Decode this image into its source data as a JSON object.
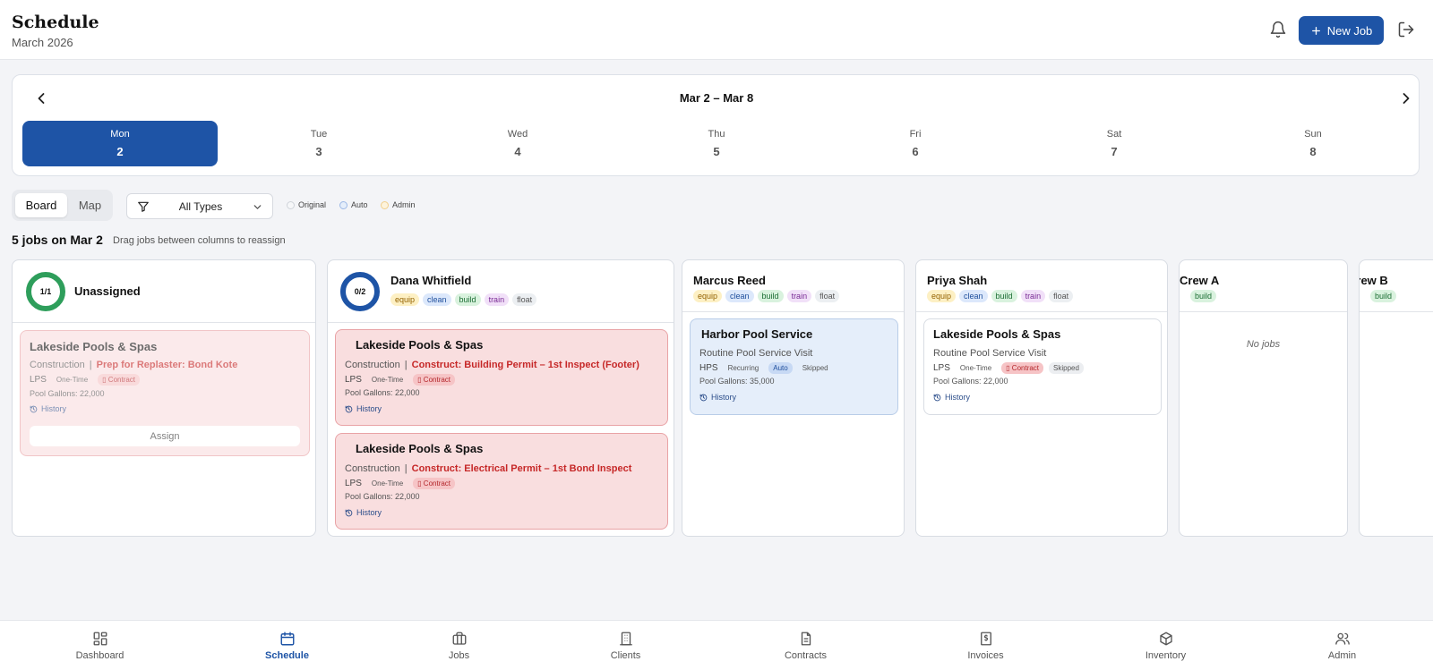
{
  "header": {
    "title": "Schedule",
    "subtitle": "March 2026",
    "new_job_label": "New Job"
  },
  "week": {
    "range_label": "Mar 2 – Mar 8",
    "days": [
      {
        "name": "Mon",
        "num": "2",
        "active": true
      },
      {
        "name": "Tue",
        "num": "3"
      },
      {
        "name": "Wed",
        "num": "4"
      },
      {
        "name": "Thu",
        "num": "5"
      },
      {
        "name": "Fri",
        "num": "6"
      },
      {
        "name": "Sat",
        "num": "7"
      },
      {
        "name": "Sun",
        "num": "8"
      }
    ]
  },
  "toolbar": {
    "view_board": "Board",
    "view_map": "Map",
    "type_filter": "All Types",
    "legend": [
      {
        "label": "Original",
        "color": "#cfd3d9"
      },
      {
        "label": "Auto",
        "color": "#9db9e6"
      },
      {
        "label": "Admin",
        "color": "#f1cf8d"
      }
    ]
  },
  "summary": {
    "count": "5 jobs on Mar 2",
    "hint": "Drag jobs between columns to reassign"
  },
  "columns": [
    {
      "name": "Unassigned",
      "ring": "1/1",
      "ring_color": "#2e9e5b",
      "jobs": [
        {
          "title": "Lakeside Pools & Spas",
          "category": "Construction",
          "task": "Prep for Replaster: Bond Kote",
          "code": "LPS",
          "freq": "One-Time",
          "contract": "Contract",
          "gallons": "Pool Gallons: 22,000",
          "history": "History",
          "assign": "Assign"
        }
      ]
    },
    {
      "name": "Dana Whitfield",
      "ring": "0/2",
      "ring_color": "#1e54a6",
      "tags": [
        "equip",
        "clean",
        "build",
        "train",
        "float"
      ],
      "jobs": [
        {
          "title": "Lakeside Pools & Spas",
          "category": "Construction",
          "task": "Construct: Building Permit – 1st Inspect (Footer)",
          "code": "LPS",
          "freq": "One-Time",
          "contract": "Contract",
          "gallons": "Pool Gallons: 22,000",
          "history": "History"
        },
        {
          "title": "Lakeside Pools & Spas",
          "category": "Construction",
          "task": "Construct: Electrical Permit – 1st Bond Inspect",
          "code": "LPS",
          "freq": "One-Time",
          "contract": "Contract",
          "gallons": "Pool Gallons: 22,000",
          "history": "History"
        }
      ]
    },
    {
      "name": "Marcus Reed",
      "tags": [
        "equip",
        "clean",
        "build",
        "train",
        "float"
      ],
      "jobs": [
        {
          "title": "Harbor Pool Service",
          "service": "Routine Pool Service Visit",
          "code": "HPS",
          "freq": "Recurring",
          "badge": "Auto",
          "status": "Skipped",
          "gallons": "Pool Gallons: 35,000",
          "history": "History"
        }
      ]
    },
    {
      "name": "Priya Shah",
      "tags": [
        "equip",
        "clean",
        "build",
        "train",
        "float"
      ],
      "jobs": [
        {
          "title": "Lakeside Pools & Spas",
          "service": "Routine Pool Service Visit",
          "code": "LPS",
          "freq": "One-Time",
          "contract": "Contract",
          "status": "Skipped",
          "gallons": "Pool Gallons: 22,000",
          "history": "History"
        }
      ]
    },
    {
      "name": "Crew A",
      "tags": [
        "build"
      ],
      "empty_label": "No jobs"
    },
    {
      "name": "Crew B",
      "tags": [
        "build"
      ]
    }
  ],
  "nav": [
    {
      "label": "Dashboard",
      "icon": "dashboard-icon"
    },
    {
      "label": "Schedule",
      "icon": "calendar-icon",
      "active": true
    },
    {
      "label": "Jobs",
      "icon": "briefcase-icon"
    },
    {
      "label": "Clients",
      "icon": "building-icon"
    },
    {
      "label": "Contracts",
      "icon": "document-icon"
    },
    {
      "label": "Invoices",
      "icon": "invoice-icon"
    },
    {
      "label": "Inventory",
      "icon": "box-icon"
    },
    {
      "label": "Admin",
      "icon": "users-icon"
    }
  ],
  "colors": {
    "primary": "#1e54a6",
    "danger": "#c62828",
    "page_bg": "#f3f4f7"
  }
}
